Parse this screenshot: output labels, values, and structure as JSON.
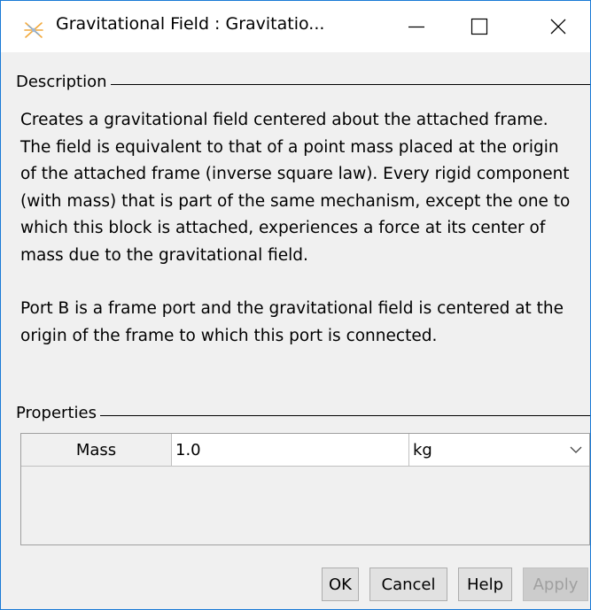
{
  "window": {
    "title": "Gravitational Field : Gravitatio...",
    "icon": "gravity-star-icon",
    "controls": [
      "minimize-icon",
      "maximize-icon",
      "close-icon"
    ]
  },
  "description": {
    "label": "Description",
    "paragraph1": "Creates a gravitational field centered about the attached frame. The field is equivalent to that of a point mass placed at the origin of the attached frame (inverse square law). Every rigid component (with mass) that is part of the same mechanism, except the one to which this block is attached, experiences a force at its center of mass due to the gravitational field.",
    "paragraph2": "Port B is a frame port and the gravitational field is centered at the origin of the frame to which this port is connected."
  },
  "properties": {
    "label": "Properties",
    "rows": [
      {
        "name": "Mass",
        "value": "1.0",
        "unit": "kg"
      }
    ]
  },
  "buttons": {
    "ok": "OK",
    "cancel": "Cancel",
    "help": "Help",
    "apply": "Apply"
  }
}
